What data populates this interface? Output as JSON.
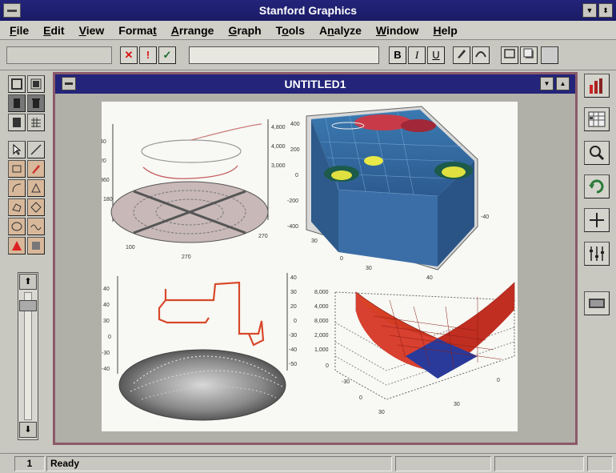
{
  "app": {
    "title": "Stanford Graphics"
  },
  "menu": [
    {
      "label": "File",
      "mnemonic_index": 0
    },
    {
      "label": "Edit",
      "mnemonic_index": 0
    },
    {
      "label": "View",
      "mnemonic_index": 0
    },
    {
      "label": "Format",
      "mnemonic_index": 5
    },
    {
      "label": "Arrange",
      "mnemonic_index": 0
    },
    {
      "label": "Graph",
      "mnemonic_index": 0
    },
    {
      "label": "Tools",
      "mnemonic_index": 1
    },
    {
      "label": "Analyze",
      "mnemonic_index": 1
    },
    {
      "label": "Window",
      "mnemonic_index": 0
    },
    {
      "label": "Help",
      "mnemonic_index": 0
    }
  ],
  "toolbar": {
    "cancel_glyph": "✕",
    "exclaim_glyph": "!",
    "confirm_glyph": "✓",
    "bold_label": "B",
    "italic_label": "I",
    "underline_label": "U"
  },
  "document": {
    "title": "UNTITLED1"
  },
  "plots": {
    "top_left": {
      "right_axis": [
        "4,800",
        "4,000",
        "3,000"
      ],
      "left_axis": [
        "40",
        "20",
        "360",
        "180"
      ],
      "bottom": [
        "100",
        "270",
        "270"
      ]
    },
    "top_right": {
      "left_axis": [
        "400",
        "200",
        "0",
        "-200",
        "-400"
      ],
      "bottom": [
        "30",
        "0",
        "30",
        "40",
        "-40"
      ]
    },
    "bottom_left": {
      "left_axis": [
        "40",
        "40",
        "30",
        "0",
        "-30",
        "-40"
      ],
      "right_axis": [
        "40",
        "30",
        "20",
        "0",
        "-30",
        "-40",
        "-50"
      ]
    },
    "bottom_right": {
      "left_axis": [
        "8,000",
        "4,000",
        "8,000",
        "2,000",
        "1,000",
        "0"
      ],
      "bottom": [
        "-30",
        "0",
        "30",
        "30",
        "0"
      ]
    }
  },
  "status": {
    "page": "1",
    "message": "Ready"
  },
  "colors": {
    "titlebar": "#23247a",
    "window_border": "#8a5a6a"
  }
}
